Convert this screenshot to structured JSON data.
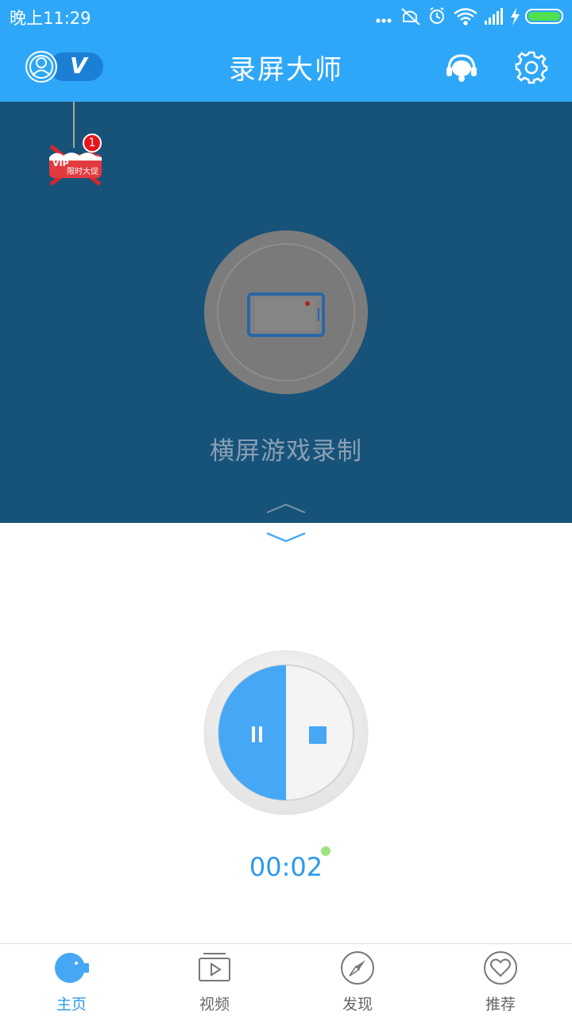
{
  "status_bar": {
    "time": "晚上11:29",
    "icons": [
      "more-dots-icon",
      "mute-icon",
      "alarm-icon",
      "wifi-icon",
      "signal-icon",
      "charging-icon",
      "battery-icon"
    ]
  },
  "app_bar": {
    "title": "录屏大师",
    "vip_badge": "V",
    "colors": {
      "bar": "#2ea7f8"
    }
  },
  "promo": {
    "badge_count": "1",
    "text_vip": "VIP",
    "text_offer": "限时大促"
  },
  "recording_mode": {
    "label": "横屏游戏录制"
  },
  "recorder": {
    "timer": "00:02",
    "status_dot_color": "#9ee37d",
    "accent": "#46a7f5"
  },
  "tabs": [
    {
      "label": "主页",
      "icon": "camera-icon",
      "active": true
    },
    {
      "label": "视频",
      "icon": "video-play-icon",
      "active": false
    },
    {
      "label": "发现",
      "icon": "compass-icon",
      "active": false
    },
    {
      "label": "推荐",
      "icon": "heart-icon",
      "active": false
    }
  ]
}
